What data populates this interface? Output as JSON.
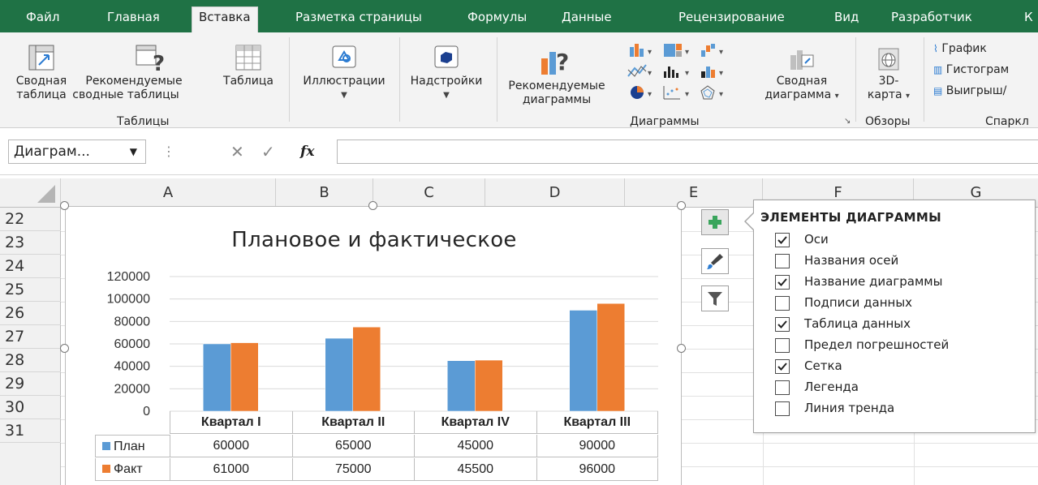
{
  "ribbon_tabs": [
    "Файл",
    "Главная",
    "Вставка",
    "Разметка страницы",
    "Формулы",
    "Данные",
    "Рецензирование",
    "Вид",
    "Разработчик",
    "К"
  ],
  "active_tab": "Вставка",
  "ribbon": {
    "pivot_table": [
      "Сводная",
      "таблица"
    ],
    "recommended_pivot": [
      "Рекомендуемые",
      "сводные таблицы"
    ],
    "table": "Таблица",
    "illustrations": "Иллюстрации",
    "addins": "Надстройки",
    "recommended_charts": [
      "Рекомендуемые",
      "диаграммы"
    ],
    "pivot_chart": [
      "Сводная",
      "диаграмма"
    ],
    "map3d": [
      "3D-",
      "карта"
    ],
    "spark_line": "График",
    "spark_column": "Гистограм",
    "spark_winloss": "Выигрыш/",
    "groups": {
      "tables": "Таблицы",
      "charts": "Диаграммы",
      "tours": "Обзоры",
      "sparklines": "Спаркл"
    }
  },
  "formula_bar": {
    "name_box": "Диаграм...",
    "fx": "fx",
    "formula": ""
  },
  "columns": [
    "A",
    "B",
    "C",
    "D",
    "E",
    "F",
    "G"
  ],
  "rows": [
    "22",
    "23",
    "24",
    "25",
    "26",
    "27",
    "28",
    "29",
    "30",
    "31"
  ],
  "chart_data": {
    "type": "bar",
    "title": "Плановое и фактическое",
    "categories": [
      "Квартал I",
      "Квартал II",
      "Квартал IV",
      "Квартал III"
    ],
    "series": [
      {
        "name": "План",
        "values": [
          60000,
          65000,
          45000,
          90000
        ],
        "color": "#5b9bd5"
      },
      {
        "name": "Факт",
        "values": [
          61000,
          75000,
          45500,
          96000
        ],
        "color": "#ed7d31"
      }
    ],
    "y_ticks": [
      "0",
      "20000",
      "40000",
      "60000",
      "80000",
      "100000",
      "120000"
    ],
    "ylim": [
      0,
      120000
    ],
    "grid": true,
    "legend": "none",
    "data_table": true,
    "table_values": {
      "plan": [
        "60000",
        "65000",
        "45000",
        "90000"
      ],
      "fact": [
        "61000",
        "75000",
        "45500",
        "96000"
      ]
    }
  },
  "chart_elements": {
    "title": "ЭЛЕМЕНТЫ ДИАГРАММЫ",
    "items": [
      {
        "label": "Оси",
        "checked": true
      },
      {
        "label": "Названия осей",
        "checked": false
      },
      {
        "label": "Название диаграммы",
        "checked": true
      },
      {
        "label": "Подписи данных",
        "checked": false
      },
      {
        "label": "Таблица данных",
        "checked": true
      },
      {
        "label": "Предел погрешностей",
        "checked": false
      },
      {
        "label": "Сетка",
        "checked": true
      },
      {
        "label": "Легенда",
        "checked": false
      },
      {
        "label": "Линия тренда",
        "checked": false
      }
    ]
  },
  "colors": {
    "tab_bar": "#1f7245",
    "plan": "#5b9bd5",
    "fact": "#ed7d31"
  }
}
